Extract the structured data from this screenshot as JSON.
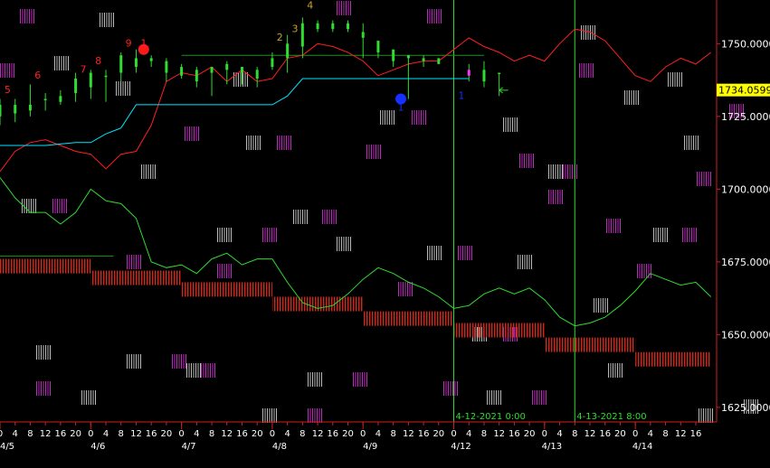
{
  "chart_data": {
    "type": "line",
    "title": "",
    "xlabel": "",
    "ylabel": "",
    "ylim": [
      1620,
      1765
    ],
    "grid": false,
    "legend": "none",
    "current_price": "1734.05999",
    "y_ticks": [
      {
        "value": 1625,
        "label": "1625.00000"
      },
      {
        "value": 1650,
        "label": "1650.00000"
      },
      {
        "value": 1675,
        "label": "1675.00000"
      },
      {
        "value": 1700,
        "label": "1700.00000"
      },
      {
        "value": 1725,
        "label": "1725.00000"
      },
      {
        "value": 1750,
        "label": "1750.00000"
      }
    ],
    "x_hour_ticks": [
      {
        "x": 0,
        "label": "0"
      },
      {
        "x": 4,
        "label": "4"
      },
      {
        "x": 8,
        "label": "8"
      },
      {
        "x": 12,
        "label": "12"
      },
      {
        "x": 16,
        "label": "16"
      },
      {
        "x": 20,
        "label": "20"
      },
      {
        "x": 24,
        "label": "0"
      },
      {
        "x": 28,
        "label": "4"
      },
      {
        "x": 32,
        "label": "8"
      },
      {
        "x": 36,
        "label": "12"
      },
      {
        "x": 40,
        "label": "16"
      },
      {
        "x": 44,
        "label": "20"
      },
      {
        "x": 48,
        "label": "0"
      },
      {
        "x": 52,
        "label": "4"
      },
      {
        "x": 56,
        "label": "8"
      },
      {
        "x": 60,
        "label": "12"
      },
      {
        "x": 64,
        "label": "16"
      },
      {
        "x": 68,
        "label": "20"
      },
      {
        "x": 72,
        "label": "0"
      },
      {
        "x": 76,
        "label": "4"
      },
      {
        "x": 80,
        "label": "8"
      },
      {
        "x": 84,
        "label": "12"
      },
      {
        "x": 88,
        "label": "16"
      },
      {
        "x": 92,
        "label": "20"
      },
      {
        "x": 96,
        "label": "0"
      },
      {
        "x": 100,
        "label": "4"
      },
      {
        "x": 104,
        "label": "8"
      },
      {
        "x": 108,
        "label": "12"
      },
      {
        "x": 112,
        "label": "16"
      },
      {
        "x": 116,
        "label": "20"
      },
      {
        "x": 120,
        "label": "0"
      },
      {
        "x": 124,
        "label": "4"
      },
      {
        "x": 128,
        "label": "8"
      },
      {
        "x": 132,
        "label": "12"
      },
      {
        "x": 136,
        "label": "16"
      },
      {
        "x": 140,
        "label": "20"
      },
      {
        "x": 144,
        "label": "0"
      },
      {
        "x": 148,
        "label": "4"
      },
      {
        "x": 152,
        "label": "8"
      },
      {
        "x": 156,
        "label": "12"
      },
      {
        "x": 160,
        "label": "16"
      },
      {
        "x": 164,
        "label": "20"
      },
      {
        "x": 168,
        "label": "0"
      },
      {
        "x": 172,
        "label": "4"
      },
      {
        "x": 176,
        "label": "8"
      },
      {
        "x": 180,
        "label": "12"
      },
      {
        "x": 184,
        "label": "16"
      }
    ],
    "x_date_ticks": [
      {
        "x": 0,
        "label": "4/5"
      },
      {
        "x": 24,
        "label": "4/6"
      },
      {
        "x": 48,
        "label": "4/7"
      },
      {
        "x": 72,
        "label": "4/8"
      },
      {
        "x": 96,
        "label": "4/9"
      },
      {
        "x": 120,
        "label": "4/12"
      },
      {
        "x": 144,
        "label": "4/13"
      },
      {
        "x": 168,
        "label": "4/14"
      }
    ],
    "session_lines": [
      {
        "x": 120,
        "label": "4-12-2021 0:00"
      },
      {
        "x": 152,
        "label": "4-13-2021 8:00"
      }
    ],
    "series": [
      {
        "color": "#ff2020",
        "x": [
          0,
          4,
          8,
          12,
          16,
          20,
          24,
          28,
          32,
          36,
          40,
          44,
          48,
          52,
          56,
          60,
          64,
          68,
          72,
          76,
          80,
          84,
          88,
          92,
          96,
          100,
          104,
          108,
          112,
          116,
          120,
          124,
          128,
          132,
          136,
          140,
          144,
          148,
          152,
          156,
          160,
          164,
          168,
          172,
          176,
          180,
          184,
          188
        ],
        "y": [
          1706,
          1713,
          1716,
          1717,
          1715,
          1713,
          1712,
          1707,
          1712,
          1713,
          1722,
          1737,
          1740,
          1739,
          1742,
          1737,
          1741,
          1737,
          1738,
          1745,
          1746,
          1750,
          1749,
          1747,
          1744,
          1739,
          1741,
          1743,
          1744,
          1744,
          1748,
          1752,
          1749,
          1747,
          1744,
          1746,
          1744,
          1750,
          1755,
          1754,
          1751,
          1745,
          1739,
          1737,
          1742,
          1745,
          1743,
          1747
        ]
      },
      {
        "color": "#00e5ff",
        "x": [
          0,
          12,
          20,
          24,
          28,
          32,
          36,
          40,
          48,
          56,
          64,
          72,
          76,
          80,
          84,
          88,
          96,
          104,
          112,
          120,
          124
        ],
        "y": [
          1715,
          1715,
          1716,
          1716,
          1719,
          1721,
          1729,
          1729,
          1729,
          1729,
          1729,
          1729,
          1732,
          1738,
          1738,
          1738,
          1738,
          1738,
          1738,
          1738,
          1738
        ]
      },
      {
        "color": "#2fdc2f",
        "x": [
          0,
          4,
          8,
          12,
          16,
          20,
          24,
          28,
          32,
          36,
          40,
          44,
          48,
          52,
          56,
          60,
          64,
          68,
          72,
          76,
          80,
          84,
          88,
          92,
          96,
          100,
          104,
          108,
          112,
          116,
          120,
          124,
          128,
          132,
          136,
          140,
          144,
          148,
          152,
          156,
          160,
          164,
          168,
          172,
          176,
          180,
          184,
          188
        ],
        "y": [
          1704,
          1697,
          1692,
          1692,
          1688,
          1692,
          1700,
          1696,
          1695,
          1690,
          1675,
          1673,
          1674,
          1671,
          1676,
          1678,
          1674,
          1676,
          1676,
          1668,
          1661,
          1659,
          1660,
          1664,
          1669,
          1673,
          1671,
          1668,
          1666,
          1663,
          1659,
          1660,
          1664,
          1666,
          1664,
          1666,
          1662,
          1656,
          1653,
          1654,
          1656,
          1660,
          1665,
          1671,
          1669,
          1667,
          1668,
          1663
        ]
      },
      {
        "color": "#cc2a1a",
        "style": "hatched-band",
        "x": [
          0,
          24,
          48,
          72,
          96,
          120,
          144,
          168,
          188
        ],
        "y": [
          1676,
          1672,
          1668,
          1663,
          1658,
          1654,
          1649,
          1644,
          1644
        ]
      }
    ],
    "candles": [
      {
        "x": 0,
        "o": 1729,
        "c": 1725,
        "h": 1731,
        "l": 1722
      },
      {
        "x": 4,
        "o": 1726,
        "c": 1729,
        "h": 1731,
        "l": 1723
      },
      {
        "x": 8,
        "o": 1729,
        "c": 1727,
        "h": 1736,
        "l": 1725
      },
      {
        "x": 12,
        "o": 1731,
        "c": 1731,
        "h": 1733,
        "l": 1727
      },
      {
        "x": 16,
        "o": 1730,
        "c": 1732,
        "h": 1734,
        "l": 1729
      },
      {
        "x": 20,
        "o": 1733,
        "c": 1738,
        "h": 1740,
        "l": 1730
      },
      {
        "x": 24,
        "o": 1735,
        "c": 1740,
        "h": 1741,
        "l": 1731
      },
      {
        "x": 28,
        "o": 1739,
        "c": 1739,
        "h": 1741,
        "l": 1730
      },
      {
        "x": 32,
        "o": 1740,
        "c": 1746,
        "h": 1747,
        "l": 1737
      },
      {
        "x": 36,
        "o": 1745,
        "c": 1742,
        "h": 1748,
        "l": 1740
      },
      {
        "x": 40,
        "o": 1744,
        "c": 1745,
        "h": 1746,
        "l": 1742
      },
      {
        "x": 44,
        "o": 1744,
        "c": 1740,
        "h": 1745,
        "l": 1737
      },
      {
        "x": 48,
        "o": 1742,
        "c": 1739,
        "h": 1743,
        "l": 1738
      },
      {
        "x": 52,
        "o": 1741,
        "c": 1737,
        "h": 1742,
        "l": 1735
      },
      {
        "x": 56,
        "o": 1742,
        "c": 1740,
        "h": 1742,
        "l": 1732
      },
      {
        "x": 60,
        "o": 1741,
        "c": 1743,
        "h": 1744,
        "l": 1736
      },
      {
        "x": 64,
        "o": 1740,
        "c": 1742,
        "h": 1742,
        "l": 1736
      },
      {
        "x": 68,
        "o": 1738,
        "c": 1741,
        "h": 1742,
        "l": 1735
      },
      {
        "x": 72,
        "o": 1742,
        "c": 1745,
        "h": 1747,
        "l": 1741
      },
      {
        "x": 76,
        "o": 1745,
        "c": 1750,
        "h": 1753,
        "l": 1740
      },
      {
        "x": 80,
        "o": 1749,
        "c": 1757,
        "h": 1759,
        "l": 1745
      },
      {
        "x": 84,
        "o": 1757,
        "c": 1755,
        "h": 1758,
        "l": 1754
      },
      {
        "x": 88,
        "o": 1755,
        "c": 1757,
        "h": 1758,
        "l": 1754
      },
      {
        "x": 92,
        "o": 1757,
        "c": 1755,
        "h": 1758,
        "l": 1754
      },
      {
        "x": 96,
        "o": 1754,
        "c": 1752,
        "h": 1757,
        "l": 1745
      },
      {
        "x": 100,
        "o": 1751,
        "c": 1747,
        "h": 1751,
        "l": 1745
      },
      {
        "x": 104,
        "o": 1748,
        "c": 1744,
        "h": 1748,
        "l": 1742
      },
      {
        "x": 108,
        "o": 1746,
        "c": 1745,
        "h": 1746,
        "l": 1731
      },
      {
        "x": 112,
        "o": 1745,
        "c": 1744,
        "h": 1746,
        "l": 1742
      },
      {
        "x": 116,
        "o": 1743,
        "c": 1745,
        "h": 1745,
        "l": 1743
      },
      {
        "x": 124,
        "o": 1739,
        "c": 1741,
        "h": 1743,
        "l": 1737
      },
      {
        "x": 128,
        "o": 1741,
        "c": 1737,
        "h": 1744,
        "l": 1735
      },
      {
        "x": 132,
        "o": 1740,
        "c": 1740,
        "h": 1740,
        "l": 1732
      }
    ],
    "resistance_lines": [
      {
        "x0": 48,
        "x1": 128,
        "y": 1746
      },
      {
        "x0": 0,
        "x1": 30,
        "y": 1677
      }
    ],
    "markers": [
      {
        "x": 38,
        "y": 1748,
        "color": "#ff1a1a"
      },
      {
        "x": 106,
        "y": 1731,
        "color": "#1530ff"
      }
    ],
    "arrow": {
      "x": 132,
      "y": 1734
    },
    "count_labels": [
      {
        "x": 2,
        "y": 1733,
        "text": "5",
        "color": "#ff2020"
      },
      {
        "x": 10,
        "y": 1738,
        "text": "6",
        "color": "#ff2020"
      },
      {
        "x": 22,
        "y": 1740,
        "text": "7",
        "color": "#ff2020"
      },
      {
        "x": 26,
        "y": 1743,
        "text": "8",
        "color": "#ff2020"
      },
      {
        "x": 34,
        "y": 1749,
        "text": "9",
        "color": "#ff2020"
      },
      {
        "x": 38,
        "y": 1749,
        "text": "1",
        "color": "#ff2020"
      },
      {
        "x": 74,
        "y": 1751,
        "text": "2",
        "color": "#c9a227"
      },
      {
        "x": 78,
        "y": 1754,
        "text": "3",
        "color": "#c9a227"
      },
      {
        "x": 82,
        "y": 1762,
        "text": "4",
        "color": "#c9a227"
      },
      {
        "x": 106,
        "y": 1727,
        "text": "1",
        "color": "#1530ff"
      },
      {
        "x": 122,
        "y": 1731,
        "text": "1",
        "color": "#1530ff"
      }
    ]
  }
}
